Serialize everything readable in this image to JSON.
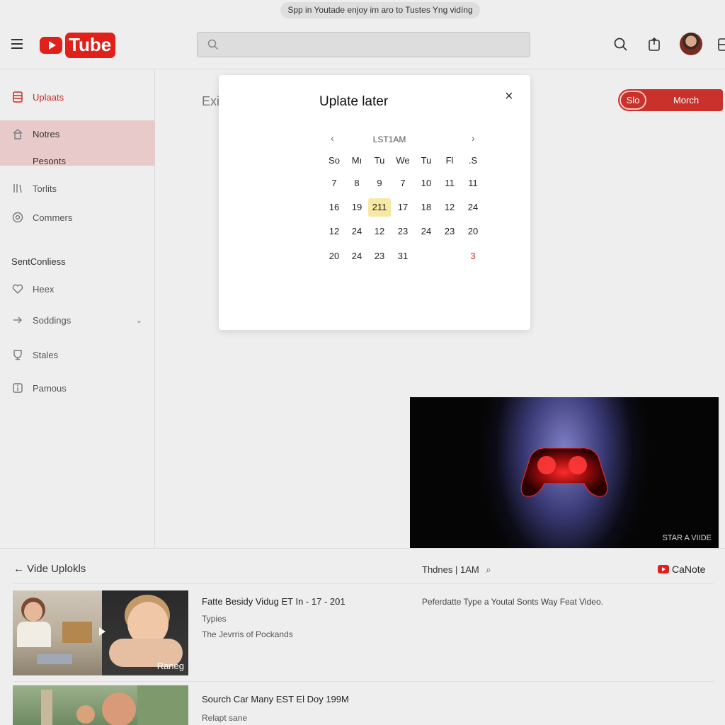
{
  "banner": {
    "text": "Spp in Youtade enjoy im aro to Tustes Yng vidíng"
  },
  "header": {
    "logo_text": "Tube",
    "search": {
      "value": "",
      "placeholder": ""
    }
  },
  "sidebar": {
    "items": [
      {
        "label": "Uplaats",
        "icon": "upload-icon",
        "active": true
      },
      {
        "label": "Notres",
        "icon": "home-icon"
      },
      {
        "label": "Pesonts"
      },
      {
        "label": "Torlits",
        "icon": "library-icon"
      },
      {
        "label": "Commers",
        "icon": "settings-icon"
      }
    ],
    "section_title": "SentConliess",
    "section_items": [
      {
        "label": "Heex",
        "icon": "heart-icon"
      },
      {
        "label": "Soddings",
        "icon": "arrow-icon"
      },
      {
        "label": "Stales",
        "icon": "trophy-icon"
      },
      {
        "label": "Pamous",
        "icon": "info-icon"
      }
    ]
  },
  "main": {
    "ex_label": "Exi",
    "pill": {
      "left": "Slo",
      "right": "Morch"
    }
  },
  "modal": {
    "title": "Uplate later",
    "close": "×",
    "calendar": {
      "month": "LST1AM",
      "prev": "‹",
      "next": "›",
      "weekdays": [
        "So",
        "Mı",
        "Tu",
        "We",
        "Tu",
        "Fl",
        ".S"
      ],
      "weeks": [
        [
          "7",
          "8",
          "9",
          "7",
          "10",
          "11",
          "11"
        ],
        [
          "16",
          "19",
          "211",
          "17",
          "18",
          "12",
          "24"
        ],
        [
          "12",
          "24",
          "12",
          "23",
          "24",
          "23",
          "20"
        ],
        [
          "20",
          "24",
          "23",
          "31",
          "",
          "",
          "3"
        ]
      ],
      "selected": "211",
      "highlight_red": "3"
    }
  },
  "video_player": {
    "caption": "STAR A VIIDE"
  },
  "uploads": {
    "title": "Vide Uplokls",
    "thdnes": "Thdnes | 1AM",
    "canote": "CaNote",
    "rows": [
      {
        "title": "Fatte Besidy Vidug ET In - 17 - 201",
        "sub1": "Typies",
        "sub2": "The Jevrris of Pockands",
        "description": "Peferdatte Type a Youtal Sonts Way Feat Video.",
        "thumb_tag": "Raneg"
      },
      {
        "title": "Sourch Car Many EST El Doy 199M",
        "sub1": "Relapt sane"
      }
    ]
  },
  "colors": {
    "brand_red": "#e0201b",
    "pill_red": "#c9312a",
    "selected_day": "#f7e9a4",
    "sidebar_active_bg": "#e8caca"
  }
}
